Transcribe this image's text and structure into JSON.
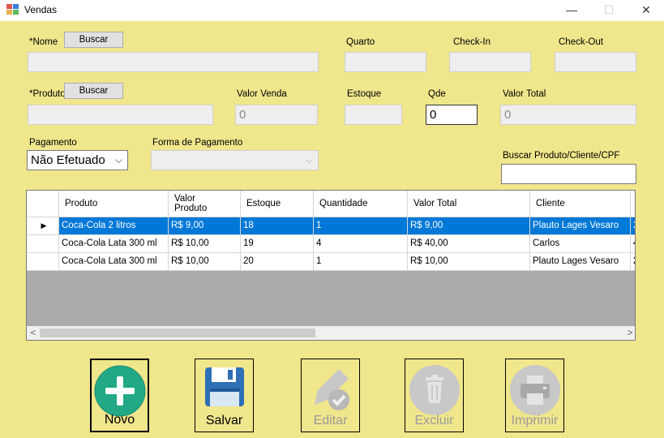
{
  "window": {
    "title": "Vendas",
    "min": "—",
    "max": "☐",
    "close": "✕"
  },
  "form": {
    "nome_label": "*Nome",
    "buscar_nome": "Buscar",
    "quarto_label": "Quarto",
    "checkin_label": "Check-In",
    "checkout_label": "Check-Out",
    "produto_label": "*Produto",
    "buscar_produto": "Buscar",
    "valor_venda_label": "Valor Venda",
    "valor_venda_value": "0",
    "estoque_label": "Estoque",
    "qde_label": "Qde",
    "qde_value": "0",
    "valor_total_label": "Valor Total",
    "valor_total_value": "0",
    "pagamento_label": "Pagamento",
    "pagamento_value": "Não Efetuado",
    "forma_pagamento_label": "Forma de Pagamento",
    "forma_pagamento_value": "",
    "buscar_geral_label": "Buscar Produto/Cliente/CPF",
    "buscar_geral_value": ""
  },
  "grid": {
    "headers": [
      "Produto",
      "Valor\nProduto",
      "Estoque",
      "Quantidade",
      "Valor Total",
      "Cliente"
    ],
    "rows": [
      [
        "Coca-Cola 2 litros",
        "R$ 9,00",
        "18",
        "1",
        "R$ 9,00",
        "Plauto Lages Vesaro",
        "2"
      ],
      [
        "Coca-Cola Lata 300 ml",
        "R$ 10,00",
        "19",
        "4",
        "R$ 40,00",
        "Carlos",
        "4"
      ],
      [
        "Coca-Cola Lata 300 ml",
        "R$ 10,00",
        "20",
        "1",
        "R$ 10,00",
        "Plauto Lages Vesaro",
        "2"
      ]
    ],
    "selected_row_indicator": "▶"
  },
  "actions": {
    "novo": "Novo",
    "salvar": "Salvar",
    "editar": "Editar",
    "excluir": "Excluir",
    "imprimir": "Imprimir"
  },
  "colors": {
    "background": "#f0e68c",
    "selection": "#0078d7",
    "novo_icon": "#22a884"
  }
}
